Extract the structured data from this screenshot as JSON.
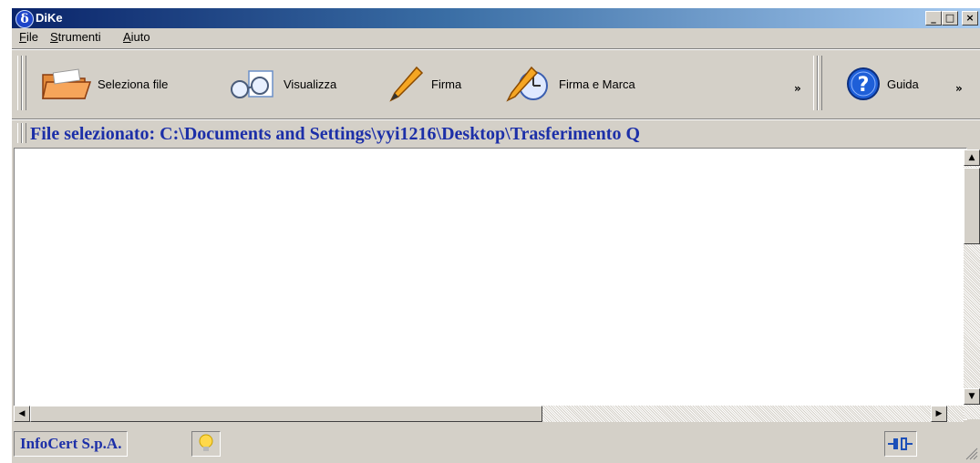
{
  "window": {
    "title": "DiKe",
    "minimize": "_",
    "maximize": "□",
    "close": "×"
  },
  "menu": [
    {
      "label_u": "F",
      "label_rest": "ile"
    },
    {
      "label_u": "S",
      "label_rest": "trumenti"
    },
    {
      "label_u": "A",
      "label_rest": "iuto"
    }
  ],
  "toolbar": {
    "select_file": "Seleziona file",
    "view": "Visualizza",
    "sign": "Firma",
    "sign_and_stamp": "Firma e Marca",
    "more": "»",
    "help": "Guida",
    "help_more": "»"
  },
  "pathbar": {
    "text": "File selezionato: C:\\Documents and Settings\\yyi1216\\Desktop\\Trasferimento Q"
  },
  "statusbar": {
    "company": "InfoCert S.p.A."
  },
  "colors": {
    "title_start": "#0a246a",
    "title_end": "#a6caf0",
    "path_text": "#1c2fa8"
  }
}
